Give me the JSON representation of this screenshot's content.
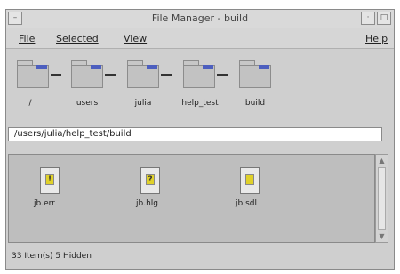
{
  "window": {
    "title": "File Manager - build"
  },
  "titlebar": {
    "menu_glyph": "–",
    "minimize_glyph": "·",
    "maximize_glyph": "□"
  },
  "menubar": {
    "items": [
      "File",
      "Selected",
      "View"
    ],
    "help": "Help"
  },
  "path_components": [
    "/",
    "users",
    "julia",
    "help_test",
    "build"
  ],
  "address": {
    "value": "/users/julia/help_test/build"
  },
  "files": [
    {
      "name": "jb.err",
      "icon": "document-icon",
      "mark": "!"
    },
    {
      "name": "jb.hlg",
      "icon": "document-icon",
      "mark": "?"
    },
    {
      "name": "jb.sdl",
      "icon": "document-icon",
      "mark": ""
    }
  ],
  "status": {
    "text": "33 Item(s) 5 Hidden"
  },
  "colors": {
    "folder_accent": "#4d5fbf",
    "window_bg": "#cfcfcf",
    "file_area_bg": "#bebebe"
  }
}
